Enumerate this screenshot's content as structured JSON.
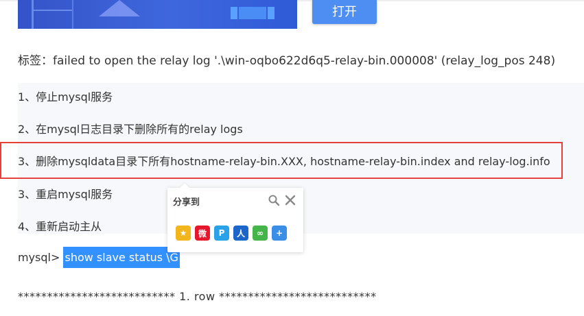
{
  "banner": {
    "open_button_label": "打开"
  },
  "article": {
    "tags_line": "标签：failed to open the relay log '.\\win-oqbo622d6q5-relay-bin.000008' (relay_log_pos 248)",
    "steps": [
      "1、停止mysql服务",
      "2、在mysql日志目录下删除所有的relay logs",
      "3、删除mysqldata目录下所有hostname-relay-bin.XXX, hostname-relay-bin.index and relay-log.info",
      "3、重启mysql服务",
      "4、重新启动主从"
    ],
    "command_prompt": "mysql> ",
    "command_selected": "show slave status \\G",
    "row_line": "*************************** 1. row ***************************"
  },
  "share_popup": {
    "title": "分享到",
    "icons": [
      {
        "name": "qzone-icon",
        "color": "#f2b51c",
        "glyph": "★"
      },
      {
        "name": "weibo-icon",
        "color": "#e6162d",
        "glyph": "微"
      },
      {
        "name": "tencent-weibo-icon",
        "color": "#2aa2e8",
        "glyph": "P"
      },
      {
        "name": "renren-icon",
        "color": "#1d66c9",
        "glyph": "人"
      },
      {
        "name": "wechat-icon",
        "color": "#44b549",
        "glyph": "∞"
      },
      {
        "name": "more-share-icon",
        "color": "#3a8ee6",
        "glyph": "+"
      }
    ]
  },
  "colors": {
    "selection": "#3390ff",
    "highlight_border": "#e5403a",
    "button": "#4e8ef3"
  }
}
